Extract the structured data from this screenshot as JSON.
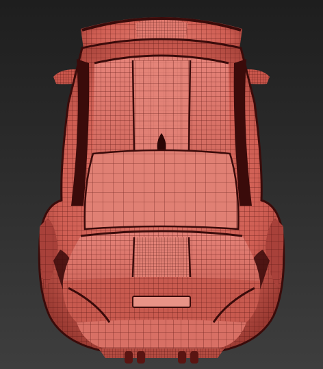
{
  "viewport": {
    "background_top": "#1e1e1e",
    "background_bottom": "#3e3e3e"
  },
  "model": {
    "subject": "car-top-view-wireframe",
    "render_mode": "shaded-wireframe",
    "surface_color": "#d9685c",
    "surface_dark": "#9a3a32",
    "wire_color": "#5a1512",
    "cavity_color": "#3a0b0a",
    "highlight_color": "#ee8a7e"
  }
}
